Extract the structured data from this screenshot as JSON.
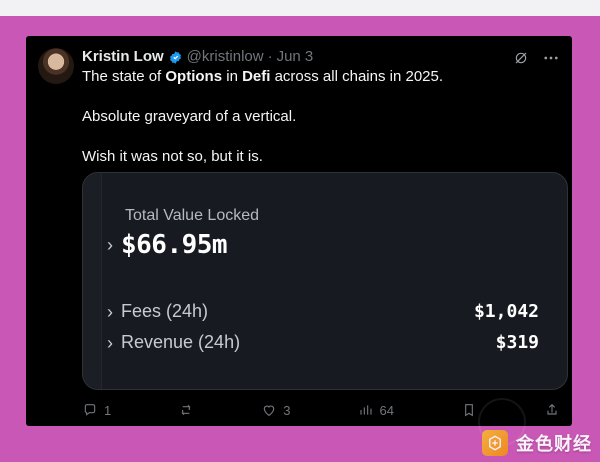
{
  "tweet": {
    "author_name": "Kristin Low",
    "handle": "@kristinlow",
    "separator": "·",
    "date": "Jun 3",
    "line1_prefix": "The state of ",
    "line1_bold1": "Options",
    "line1_middle": " in ",
    "line1_bold2": "Defi",
    "line1_suffix": " across all chains in 2025.",
    "line2": "Absolute graveyard of a vertical.",
    "line3": "Wish it was not so, but it is."
  },
  "embedded_image": {
    "tvl_label": "Total Value Locked",
    "tvl_value": "$66.95m",
    "fees_label": "Fees (24h)",
    "fees_value": "$1,042",
    "revenue_label": "Revenue (24h)",
    "revenue_value": "$319"
  },
  "actions": {
    "reply_count": "1",
    "like_count": "3",
    "views_count": "64"
  },
  "watermark": {
    "text": "金色财经"
  },
  "icons": {
    "verified": "verified-badge-icon",
    "grok": "grok-icon",
    "more": "more-icon",
    "reply": "reply-icon",
    "repost": "repost-icon",
    "like": "like-icon",
    "views": "views-icon",
    "bookmark": "bookmark-icon",
    "share": "share-icon"
  },
  "colors": {
    "background": "#c957b5",
    "tweet_background": "#000000",
    "card_background": "#171b21",
    "accent": "#1d9bf0",
    "muted_text": "#71767b"
  }
}
